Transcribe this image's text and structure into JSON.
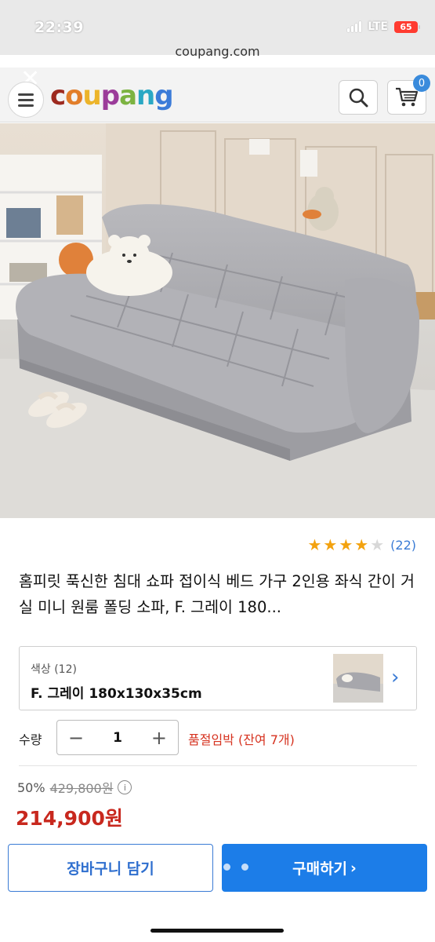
{
  "status_bar": {
    "time": "22:39",
    "network": "LTE",
    "battery": "65"
  },
  "browser": {
    "url": "coupang.com"
  },
  "header": {
    "logo": [
      "c",
      "o",
      "u",
      "p",
      "a",
      "n",
      "g"
    ],
    "cart_count": "0"
  },
  "colors": {
    "logo": [
      "#9d2a1f",
      "#e27e2a",
      "#ecb42a",
      "#9b3c9a",
      "#7cb341",
      "#2aa8c4",
      "#3b7bd8"
    ],
    "accent": "#1c7de8",
    "price": "#c8281e",
    "star": "#f3a20f"
  },
  "product": {
    "rating_stars": 4,
    "review_count": "(22)",
    "title": "홈피릿 푹신한 침대 쇼파 접이식 베드 가구 2인용 좌식 간이 거실 미니 원룸 폴딩 소파, F. 그레이 180...",
    "option": {
      "label": "색상 (12)",
      "value": "F. 그레이 180x130x35cm"
    },
    "quantity": {
      "label": "수량",
      "value": "1",
      "minus": "−",
      "plus": "+"
    },
    "stock_warning": "품절임박 (잔여 7개)",
    "price": {
      "discount": "50%",
      "original": "429,800원",
      "sale": "214,900원"
    }
  },
  "actions": {
    "add_to_cart": "장바구니 담기",
    "buy_now": "구매하기",
    "buy_chevron": "›"
  }
}
